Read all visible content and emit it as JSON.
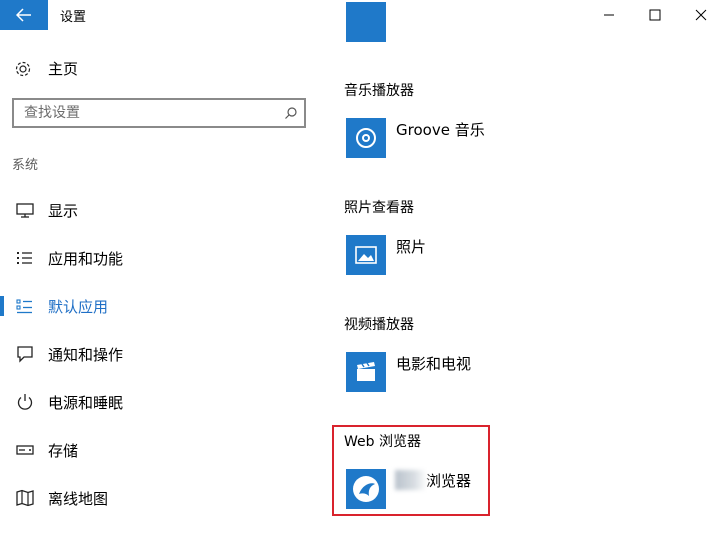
{
  "window": {
    "title": "设置",
    "icons": {
      "back": "arrow-left-icon",
      "minimize": "minimize-icon",
      "maximize": "maximize-icon",
      "close": "close-icon"
    }
  },
  "sidebar": {
    "home_label": "主页",
    "search_placeholder": "查找设置",
    "section_label": "系统",
    "items": [
      {
        "label": "显示",
        "icon": "monitor-icon"
      },
      {
        "label": "应用和功能",
        "icon": "list-icon"
      },
      {
        "label": "默认应用",
        "icon": "default-apps-icon",
        "active": true
      },
      {
        "label": "通知和操作",
        "icon": "notification-icon"
      },
      {
        "label": "电源和睡眠",
        "icon": "power-icon"
      },
      {
        "label": "存储",
        "icon": "storage-icon"
      },
      {
        "label": "离线地图",
        "icon": "map-icon"
      }
    ]
  },
  "main": {
    "categories": [
      {
        "label": "音乐播放器",
        "app": "Groove 音乐",
        "icon": "groove-music-icon"
      },
      {
        "label": "照片查看器",
        "app": "照片",
        "icon": "photos-icon"
      },
      {
        "label": "视频播放器",
        "app": "电影和电视",
        "icon": "movies-tv-icon"
      },
      {
        "label": "Web 浏览器",
        "app": "浏览器",
        "icon": "browser-icon"
      }
    ]
  },
  "colors": {
    "accent": "#1f79c9",
    "highlight": "#d9232d"
  }
}
